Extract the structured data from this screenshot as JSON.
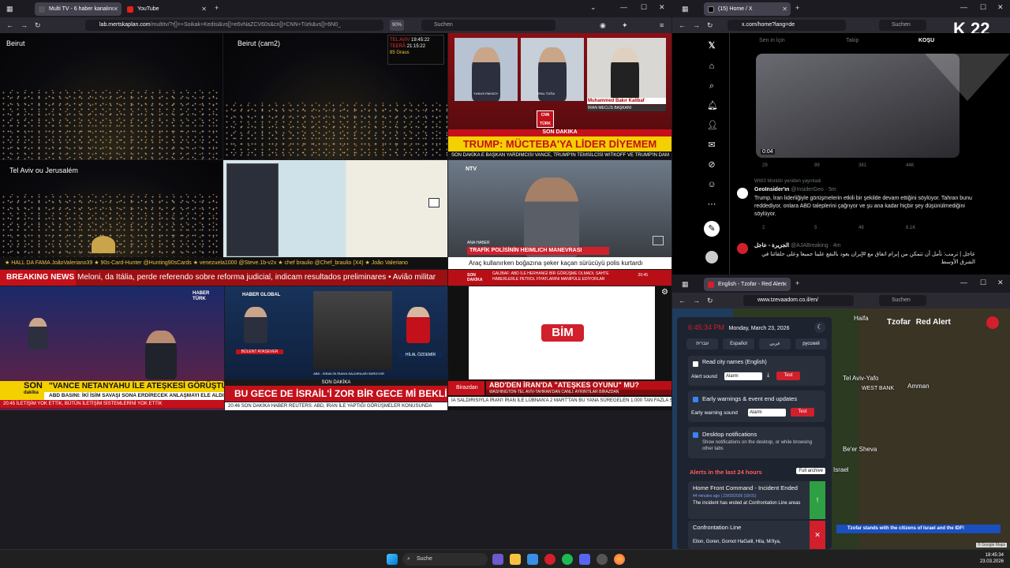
{
  "left_browser": {
    "tabs": [
      {
        "label": "Multi TV - 6 haber kanalını",
        "active": true
      },
      {
        "label": "YouTube",
        "active": false
      }
    ],
    "url_host": "lab.mertskaplan.com",
    "url_path": "/multitv/?r[]=+Soikak+Kedisi&vs[]=e6vNaZCV60s&cn[]=CNN+Türk&vs[]=6N0_",
    "zoom": "90%",
    "search_placeholder": "Suchen"
  },
  "cams": {
    "cam1": "Beirut",
    "cam2": "Beirut (cam2)",
    "cam3": "Tel Aviv ou Jerusalém"
  },
  "cnn": {
    "clock_tel_aviv_label": "TEL AVIV",
    "clock_tel_aviv": "19:45:22",
    "clock_tehran_label": "TEERÃ",
    "clock_tehran": "21:15:22",
    "weather": "85 Graus",
    "name1": "YUNUS PAKSOY",
    "name2": "ORAL TOĞA",
    "name3": "Muhammed Bakır Kalibaf",
    "name3_role": "İRAN MECLİS BAŞKANI",
    "logo": "CNN TÜRK",
    "son_dakika": "SON DAKİKA",
    "headline": "TRUMP: MÜCTEBA'YA LİDER DİYEMEM",
    "ticker": "SON DAKİKA  E BAŞKAN YARDIMCISI VANCE, TRUMP'IN TEMSİLCİSİ WITKOFF VE TRUMP'IN DAM"
  },
  "ntv": {
    "logo": "NTV",
    "tag": "ANA HABER",
    "title": "TRAFİK POLİSİNİN HEIMLICH MANEVRASI",
    "subtitle": "Araç kullanırken boğazına şeker kaçan sürücüyü polis kurtardı",
    "ticker_left": "SON DAKİKA",
    "ticker": "GALİBAF: ABD İLE HERHANGİ BİR GÖRÜŞME OLMADI, SAHTE HABERLERLE PETROL FİYATLARINI MANİPÜLE EDİYORLAR",
    "time": "20:45"
  },
  "chat_ticker": "★ HALL DA FAMA  JoãoValeriano39  ★ 90s-Card-Hunter @Hunting90sCards  ★ venezuela1000 @Steve.1b-v2x  ★ chef braulio @Chef_braulio (X4)  ★ João Valeriano",
  "breaking": {
    "label": "BREAKING NEWS",
    "text": "Meloni, da Itália, perde referendo sobre reforma judicial, indicam resultados preliminares  •  Avião militar"
  },
  "haberturk": {
    "logo": "HABER TÜRK",
    "son": "SON",
    "dakika": "dakika",
    "headline": "\"VANCE NETANYAHU İLE ATEŞKESİ GÖRÜŞTÜ\"",
    "sub": "ABD BASINI: İKİ İSİM SAVAŞI SONA ERDİRECEK ANLAŞMAYI ELE ALDI",
    "ticker": "İLETİŞİM YOK ETTİK, BÜTÜN İLETİŞİM SİSTEMLERİNİ YOK ETTİK",
    "time": "20:45"
  },
  "haberglobal": {
    "logo": "HABER GLOBAL",
    "name_left": "BÜLENT ATASEVER",
    "name_right": "HİLAL ÖZDEMİR",
    "mid_caption": "ABD - İSRAİL'İN İRAN'A SALDIRILARI SÜRÜYOR",
    "son_dakika": "SON DAKİKA",
    "headline": "BU GECE DE İSRAİL'İ ZOR BİR GECE Mİ BEKLİYOR?",
    "ticker": "20:46  SON DAKİKA HABER  REUTERS: ABD, İRAN İLE YAPTIĞI GÖRÜŞMELER KONUSUNDA"
  },
  "bim": {
    "logo": "BİM",
    "channel": "Birazdan",
    "headline": "ABD'DEN İRAN'DA \"ATEŞKES OYUNU\" MU?",
    "sub": "WASHINGTON-TEL AVİV-TAHRAN'DAN CANLI: AYRINTILAR BİRAZDAN",
    "ticker": "İA SALDIRISIYLA İRAN'I  İRAN İLE LÜBNAN'A 2 MART'TAN BU YANA SÜREGELEN 1.000 TAN FAZLA SALDIRI"
  },
  "x_browser": {
    "tab": "(15) Home / X",
    "url": "x.com/home?lang=de",
    "search": "Suchen",
    "tabs": [
      "Sen in İçin",
      "Takip",
      "KOŞU"
    ],
    "video_time": "0:04",
    "stats1": [
      "29",
      "99",
      "381",
      "44K"
    ],
    "retweet_note": "WW3 Monitör yeniden yayınladı",
    "post1_name": "GeoInsider'ın",
    "post1_handle": "@InsiderGeo · 5m",
    "post1_text": "Trump, İran liderliğiyle görüşmelerin etkili bir şekilde devam ettiğini söylüyor. Tahran bunu reddediyor, onlara ABD taleplerini çağrıyor ve şu ana kadar hiçbir şey düşünülmediğini söylüyor.",
    "stats2": [
      "2",
      "5",
      "48",
      "6.1K"
    ],
    "post2_name": "الجزيرة - عاجل",
    "post2_handle": "@AJABreaking · 4m",
    "post2_text": "عاجل | ترمب: تأمل أن تتمكن من إبرام اتفاق مع #إيران يعود بالنفع علينا جميعا وعلى حلفائنا في الشرق الأوسط",
    "badge": "K 22"
  },
  "tz_browser": {
    "tab": "English - Tzofar - Red Alert",
    "url": "www.tzevaadom.co.il/en/",
    "search": "Suchen",
    "time": "6:45:34 PM",
    "date": "Monday, March 23, 2026",
    "languages": [
      "עברית",
      "Español",
      "عربي",
      "русский"
    ],
    "read_city": "Read city names (English)",
    "alert_sound_label": "Alert sound",
    "alert_sound_value": "Alarm",
    "test": "Test",
    "early_warnings": "Early warnings & event end updates",
    "early_sound_label": "Early warning sound",
    "desktop_notif": "Desktop notifications",
    "desktop_notif_desc": "Show notifications on the desktop, or while browsing other tabs",
    "alerts_title": "Alerts in the last 24 hours",
    "full_archive": "Full archive",
    "alert1_title": "Home Front Command - Incident Ended",
    "alert1_meta": "44 minutes ago | 23/03/2026 (18:01)",
    "alert1_text": "The incident has ended at Confrontation Line areas",
    "alert2_title": "Confrontation Line",
    "alert2_text": "Eilon, Goren, Gornot HaGalil, Hila, Mi'ilya,",
    "brand": "Tzofar",
    "brand2": "Red Alert",
    "map_labels": [
      "Haifa",
      "Tel Aviv-Yafo",
      "WEST BANK",
      "Amman",
      "Be'er Sheva",
      "Israel"
    ],
    "banner": "Tzofar stands with the citizens of Israel and the IDF!",
    "google": "© Google Maps"
  },
  "taskbar": {
    "search": "Suche",
    "time": "18:45:34",
    "date": "23.03.2026"
  }
}
